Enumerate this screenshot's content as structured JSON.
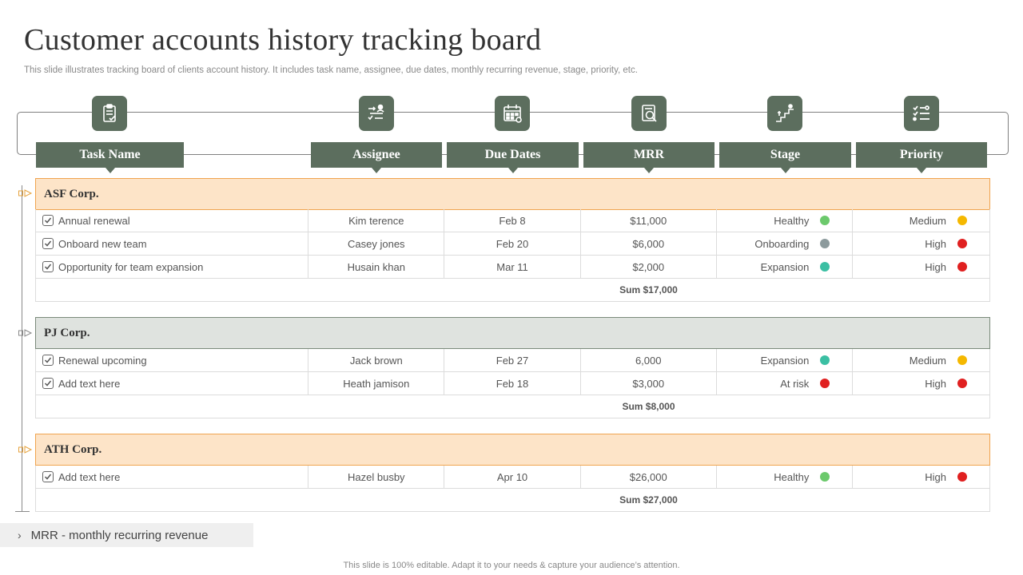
{
  "page": {
    "title": "Customer accounts history tracking board",
    "subtitle": "This slide illustrates tracking board of clients account history. It includes task name, assignee, due dates, monthly recurring revenue, stage, priority, etc."
  },
  "columns": {
    "task": "Task Name",
    "assignee": "Assignee",
    "due": "Due Dates",
    "mrr": "MRR",
    "stage": "Stage",
    "priority": "Priority"
  },
  "column_icons": {
    "task": "clipboard-icon",
    "assignee": "assignment-flow-icon",
    "due": "calendar-icon",
    "mrr": "report-search-icon",
    "stage": "stairs-climb-icon",
    "priority": "checklist-icon"
  },
  "status_colors": {
    "healthy": "#6cc96c",
    "onboarding": "#8c9a9c",
    "expansion": "#3bbfa3",
    "at_risk": "#e02020",
    "medium": "#f5b800",
    "high": "#e02020"
  },
  "groups": [
    {
      "name": "ASF Corp.",
      "rows": [
        {
          "task": "Annual renewal",
          "assignee": "Kim terence",
          "due": "Feb 8",
          "mrr": "$11,000",
          "stage": "Healthy",
          "priority": "Medium"
        },
        {
          "task": "Onboard new team",
          "assignee": "Casey jones",
          "due": "Feb 20",
          "mrr": "$6,000",
          "stage": "Onboarding",
          "priority": "High"
        },
        {
          "task": "Opportunity for team expansion",
          "assignee": "Husain khan",
          "due": "Mar 11",
          "mrr": "$2,000",
          "stage": "Expansion",
          "priority": "High"
        }
      ],
      "sum": "Sum $17,000"
    },
    {
      "name": "PJ Corp.",
      "rows": [
        {
          "task": "Renewal  upcoming",
          "assignee": "Jack brown",
          "due": "Feb 27",
          "mrr": "6,000",
          "stage": "Expansion",
          "priority": "Medium"
        },
        {
          "task": "Add text here",
          "assignee": "Heath jamison",
          "due": "Feb 18",
          "mrr": "$3,000",
          "stage": "At risk",
          "priority": "High"
        }
      ],
      "sum": "Sum $8,000"
    },
    {
      "name": "ATH Corp.",
      "rows": [
        {
          "task": "Add text here",
          "assignee": "Hazel busby",
          "due": "Apr 10",
          "mrr": "$26,000",
          "stage": "Healthy",
          "priority": "High"
        }
      ],
      "sum": "Sum $27,000"
    }
  ],
  "legend": "MRR - monthly recurring revenue",
  "footer": "This slide is 100% editable. Adapt it to your needs & capture your audience’s attention."
}
